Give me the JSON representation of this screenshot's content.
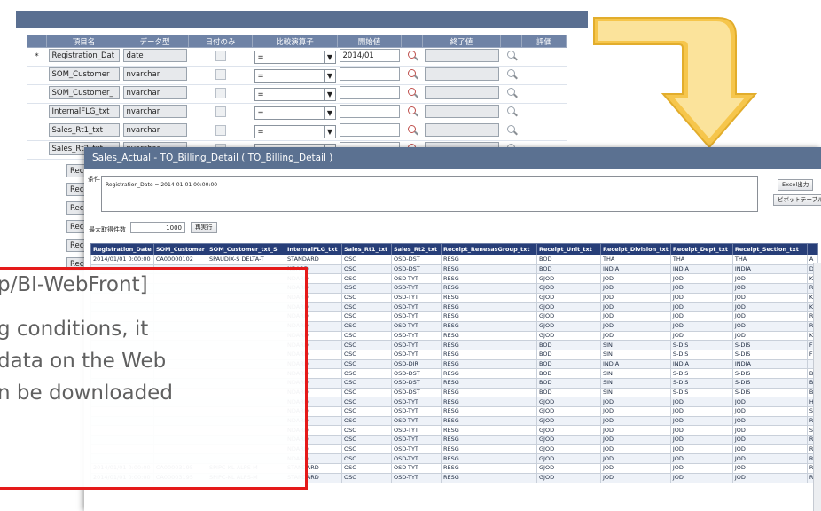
{
  "condition_editor": {
    "headers": [
      "項目名",
      "データ型",
      "日付のみ",
      "比較演算子",
      "開始値",
      "",
      "終了値",
      "",
      "評価"
    ],
    "rows": [
      {
        "marker": "*",
        "field": "Registration_Dat",
        "type": "date",
        "op": "=",
        "start": "2014/01",
        "end": ""
      },
      {
        "marker": "",
        "field": "SOM_Customer",
        "type": "nvarchar",
        "op": "=",
        "start": "",
        "end": ""
      },
      {
        "marker": "",
        "field": "SOM_Customer_",
        "type": "nvarchar",
        "op": "=",
        "start": "",
        "end": ""
      },
      {
        "marker": "",
        "field": "InternalFLG_txt",
        "type": "nvarchar",
        "op": "=",
        "start": "",
        "end": ""
      },
      {
        "marker": "",
        "field": "Sales_Rt1_txt",
        "type": "nvarchar",
        "op": "=",
        "start": "",
        "end": ""
      },
      {
        "marker": "",
        "field": "Sales_Rt2_txt",
        "type": "nvarchar",
        "op": "=",
        "start": "",
        "end": ""
      }
    ],
    "left_rows": [
      "Receipt_",
      "Receipt_",
      "Receipt_",
      "Receipt_",
      "Receipt_",
      "Receipt_"
    ]
  },
  "result_window": {
    "title": "Sales_Actual - TO_Billing_Detail ( TO_Billing_Detail )",
    "condition_label": "条件",
    "condition_text": "Registration_Date = 2014-01-01 00:00:00",
    "excel_button": "Excel出力",
    "pivot_button": "ピボットテーブル",
    "max_rows_label": "最大取得件数",
    "max_rows_value": "1000",
    "rerun_button": "再実行",
    "columns": [
      "Registration_Date",
      "SOM_Customer",
      "SOM_Customer_txt_S",
      "InternalFLG_txt",
      "Sales_Rt1_txt",
      "Sales_Rt2_txt",
      "Receipt_RenesasGroup_txt",
      "Receipt_Unit_txt",
      "Receipt_Division_txt",
      "Receipt_Dept_txt",
      "Receipt_Section_txt",
      ""
    ],
    "rows": [
      [
        "2014/01/01 0:00:00",
        "CA00000102",
        "SPAUDIX-S DELTA-T",
        "STANDARD",
        "OSC",
        "OSD-DST",
        "RESG",
        "BOD",
        "THA",
        "THA",
        "THA",
        "A"
      ],
      [
        "",
        "",
        "",
        "NDARD",
        "OSC",
        "OSD-DST",
        "RESG",
        "BOD",
        "INDIA",
        "INDIA",
        "INDIA",
        "D"
      ],
      [
        "",
        "",
        "",
        "NDARD",
        "OSC",
        "OSD-TYT",
        "RESG",
        "GJOD",
        "JOD",
        "JOD",
        "JOD",
        "K"
      ],
      [
        "",
        "",
        "",
        "NDARD",
        "OSC",
        "OSD-TYT",
        "RESG",
        "GJOD",
        "JOD",
        "JOD",
        "JOD",
        "R"
      ],
      [
        "",
        "",
        "",
        "NDARD",
        "OSC",
        "OSD-TYT",
        "RESG",
        "GJOD",
        "JOD",
        "JOD",
        "JOD",
        "K"
      ],
      [
        "",
        "",
        "",
        "NDARD",
        "OSC",
        "OSD-TYT",
        "RESG",
        "GJOD",
        "JOD",
        "JOD",
        "JOD",
        "K"
      ],
      [
        "",
        "",
        "",
        "NDARD",
        "OSC",
        "OSD-TYT",
        "RESG",
        "GJOD",
        "JOD",
        "JOD",
        "JOD",
        "R"
      ],
      [
        "",
        "",
        "",
        "NDARD",
        "OSC",
        "OSD-TYT",
        "RESG",
        "GJOD",
        "JOD",
        "JOD",
        "JOD",
        "R"
      ],
      [
        "",
        "",
        "",
        "NDARD",
        "OSC",
        "OSD-TYT",
        "RESG",
        "GJOD",
        "JOD",
        "JOD",
        "JOD",
        "K"
      ],
      [
        "",
        "",
        "",
        "NDARD",
        "OSC",
        "OSD-TYT",
        "RESG",
        "BOD",
        "SIN",
        "S-DIS",
        "S-DIS",
        "F"
      ],
      [
        "",
        "",
        "",
        "NDARD",
        "OSC",
        "OSD-TYT",
        "RESG",
        "BOD",
        "SIN",
        "S-DIS",
        "S-DIS",
        "F"
      ],
      [
        "",
        "",
        "",
        "NDARD",
        "OSC",
        "OSD-DIR",
        "RESG",
        "BOD",
        "INDIA",
        "INDIA",
        "INDIA",
        ""
      ],
      [
        "",
        "",
        "",
        "NDARD",
        "OSC",
        "OSD-DST",
        "RESG",
        "BOD",
        "SIN",
        "S-DIS",
        "S-DIS",
        "B"
      ],
      [
        "",
        "",
        "",
        "NDARD",
        "OSC",
        "OSD-DST",
        "RESG",
        "BOD",
        "SIN",
        "S-DIS",
        "S-DIS",
        "B"
      ],
      [
        "",
        "",
        "",
        "NDARD",
        "OSC",
        "OSD-DST",
        "RESG",
        "BOD",
        "SIN",
        "S-DIS",
        "S-DIS",
        "B"
      ],
      [
        "",
        "",
        "",
        "NDARD",
        "OSC",
        "OSD-TYT",
        "RESG",
        "GJOD",
        "JOD",
        "JOD",
        "JOD",
        "H"
      ],
      [
        "",
        "",
        "",
        "NDARD",
        "OSC",
        "OSD-TYT",
        "RESG",
        "GJOD",
        "JOD",
        "JOD",
        "JOD",
        "S"
      ],
      [
        "",
        "",
        "",
        "NDARD",
        "OSC",
        "OSD-TYT",
        "RESG",
        "GJOD",
        "JOD",
        "JOD",
        "JOD",
        "R"
      ],
      [
        "",
        "",
        "",
        "NDARD",
        "OSC",
        "OSD-TYT",
        "RESG",
        "GJOD",
        "JOD",
        "JOD",
        "JOD",
        "S"
      ],
      [
        "",
        "",
        "",
        "NDARD",
        "OSC",
        "OSD-TYT",
        "RESG",
        "GJOD",
        "JOD",
        "JOD",
        "JOD",
        "R"
      ],
      [
        "",
        "",
        "",
        "NDARD",
        "OSC",
        "OSD-TYT",
        "RESG",
        "GJOD",
        "JOD",
        "JOD",
        "JOD",
        "R"
      ],
      [
        "",
        "",
        "",
        "NDARD",
        "OSC",
        "OSD-TYT",
        "RESG",
        "GJOD",
        "JOD",
        "JOD",
        "JOD",
        "R"
      ],
      [
        "2014/01/01 0:00:00",
        "CA00003195",
        "SPIPC-KL ALPS-M",
        "STANDARD",
        "OSC",
        "OSD-TYT",
        "RESG",
        "GJOD",
        "JOD",
        "JOD",
        "JOD",
        "R"
      ],
      [
        "2014/01/01 0:00:00",
        "CA00003195",
        "SPIPC-KL ALPS-M",
        "STANDARD",
        "OSC",
        "OSD-TYT",
        "RESG",
        "GJOD",
        "JOD",
        "JOD",
        "JOD",
        "R"
      ]
    ]
  },
  "callout": {
    "lines": [
      "p/BI-WebFront]",
      "g conditions, it",
      "data on the Web",
      "n be downloaded"
    ],
    "border_color": "#e51a1a"
  },
  "colors": {
    "accent_arrow": "#f6c64c",
    "title_bar": "#5b7191",
    "table_header": "#273e78"
  }
}
